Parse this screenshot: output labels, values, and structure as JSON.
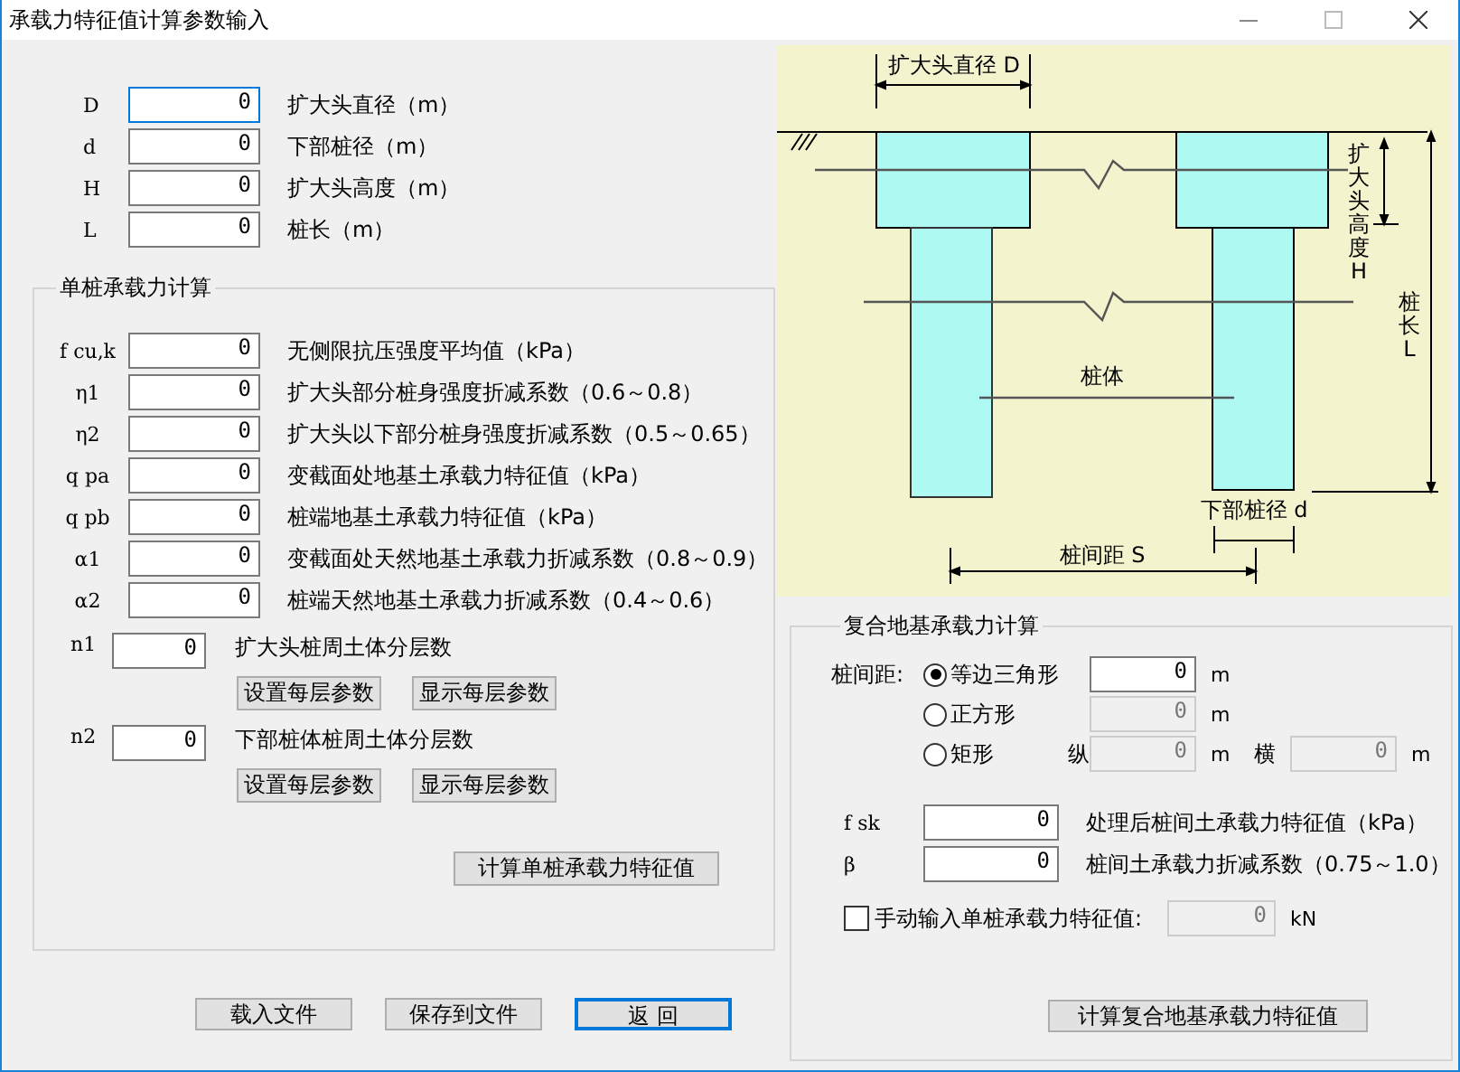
{
  "window": {
    "title": "承载力特征值计算参数输入"
  },
  "geometry_fields": [
    {
      "symbol": "D",
      "value": "0",
      "label": "扩大头直径（m）",
      "focused": true
    },
    {
      "symbol": "d",
      "value": "0",
      "label": "下部桩径（m）",
      "focused": false
    },
    {
      "symbol": "H",
      "value": "0",
      "label": "扩大头高度（m）",
      "focused": false
    },
    {
      "symbol": "L",
      "value": "0",
      "label": "桩长（m）",
      "focused": false
    }
  ],
  "single_pile": {
    "title": "单桩承载力计算",
    "fields": [
      {
        "symbol": "f cu,k",
        "value": "0",
        "label": "无侧限抗压强度平均值（kPa）"
      },
      {
        "symbol": "η1",
        "value": "0",
        "label": "扩大头部分桩身强度折减系数（0.6～0.8）"
      },
      {
        "symbol": "η2",
        "value": "0",
        "label": "扩大头以下部分桩身强度折减系数（0.5～0.65）"
      },
      {
        "symbol": "q pa",
        "value": "0",
        "label": "变截面处地基土承载力特征值（kPa）"
      },
      {
        "symbol": "q pb",
        "value": "0",
        "label": "桩端地基土承载力特征值（kPa）"
      },
      {
        "symbol": "α1",
        "value": "0",
        "label": "变截面处天然地基土承载力折减系数（0.8～0.9）"
      },
      {
        "symbol": "α2",
        "value": "0",
        "label": "桩端天然地基土承载力折减系数（0.4～0.6）"
      }
    ],
    "layers": [
      {
        "symbol": "n1",
        "value": "0",
        "label": "扩大头桩周土体分层数",
        "buttons": [
          "设置每层参数",
          "显示每层参数"
        ]
      },
      {
        "symbol": "n2",
        "value": "0",
        "label": "下部桩体桩周土体分层数",
        "buttons": [
          "设置每层参数",
          "显示每层参数"
        ]
      }
    ],
    "calc_button": "计算单桩承载力特征值"
  },
  "diagram": {
    "head_diameter": "扩大头直径 D",
    "head_height": "扩大头高度H",
    "pile_length": "桩长L",
    "pile_body": "桩体",
    "lower_diameter": "下部桩径 d",
    "spacing": "桩间距 S"
  },
  "composite": {
    "title": "复合地基承载力计算",
    "spacing_label": "桩间距:",
    "options": [
      {
        "label": "等边三角形",
        "selected": true,
        "inputs": [
          {
            "value": "0",
            "unit": "m",
            "disabled": false
          }
        ]
      },
      {
        "label": "正方形",
        "selected": false,
        "inputs": [
          {
            "value": "0",
            "unit": "m",
            "disabled": true
          }
        ]
      },
      {
        "label": "矩形",
        "selected": false,
        "inputs": [
          {
            "prefix": "纵",
            "value": "0",
            "unit": "m",
            "disabled": true
          },
          {
            "prefix": "横",
            "value": "0",
            "unit": "m",
            "disabled": true
          }
        ]
      }
    ],
    "fields": [
      {
        "symbol": "f sk",
        "value": "0",
        "label": "处理后桩间土承载力特征值（kPa）"
      },
      {
        "symbol": "β",
        "value": "0",
        "label": "桩间土承载力折减系数（0.75～1.0）"
      }
    ],
    "manual": {
      "label": "手动输入单桩承载力特征值:",
      "checked": false,
      "value": "0",
      "unit": "kN",
      "disabled": true
    },
    "calc_button": "计算复合地基承载力特征值"
  },
  "buttons": [
    {
      "label": "载入文件",
      "default": false
    },
    {
      "label": "保存到文件",
      "default": false
    },
    {
      "label": "返 回",
      "default": true
    }
  ]
}
